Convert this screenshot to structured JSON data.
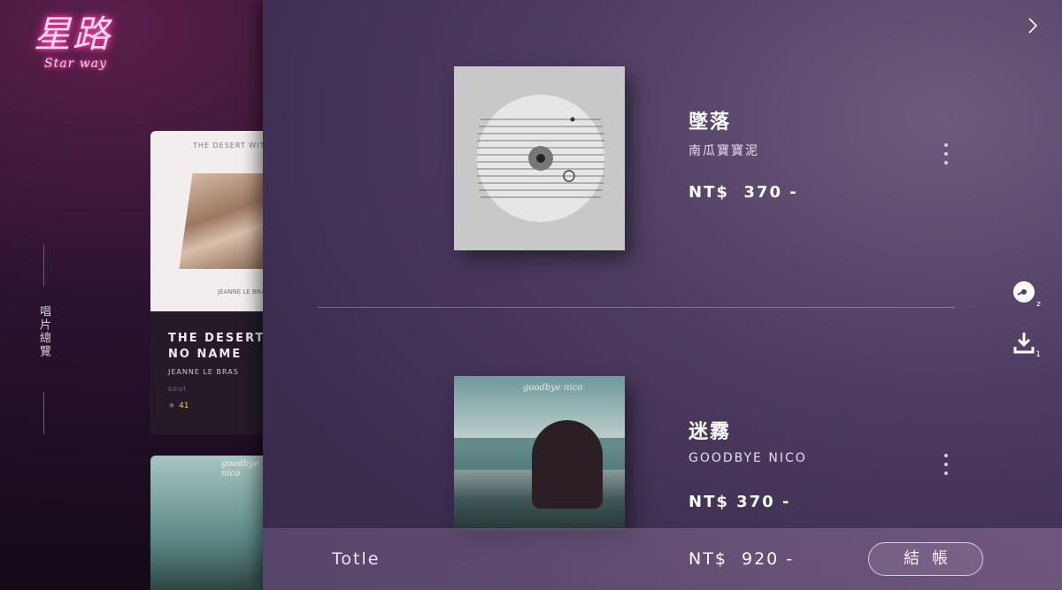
{
  "brand": {
    "logo_cn": "星路",
    "logo_en": "Star way"
  },
  "sidebar": {
    "nav_label": "唱片總覽"
  },
  "background_cards": [
    {
      "cover_title": "THE DESERT WITH NO",
      "cover_author": "JEANNE LE BRAS",
      "title_line1": "THE DESERT",
      "title_line2": "NO NAME",
      "artist": "JEANNE LE BRAS",
      "genre": "soul",
      "rating": "41"
    },
    {
      "cover_title": "goodbye nico"
    }
  ],
  "cart": {
    "close_icon": "chevron-right-icon",
    "items": [
      {
        "title": "墜落",
        "artist": "南瓜寶寶泥",
        "price": "NT$  370 -"
      },
      {
        "title": "迷霧",
        "artist": "GOODBYE NICO",
        "price": "NT$ 370 -",
        "cover_title": "goodbye nico"
      }
    ],
    "side_icons": [
      {
        "name": "vinyl-icon",
        "badge": "z"
      },
      {
        "name": "download-icon",
        "badge": "1"
      }
    ],
    "footer": {
      "total_label": "Totle",
      "total_price": "NT$  920 -",
      "checkout_label": "結帳"
    }
  }
}
